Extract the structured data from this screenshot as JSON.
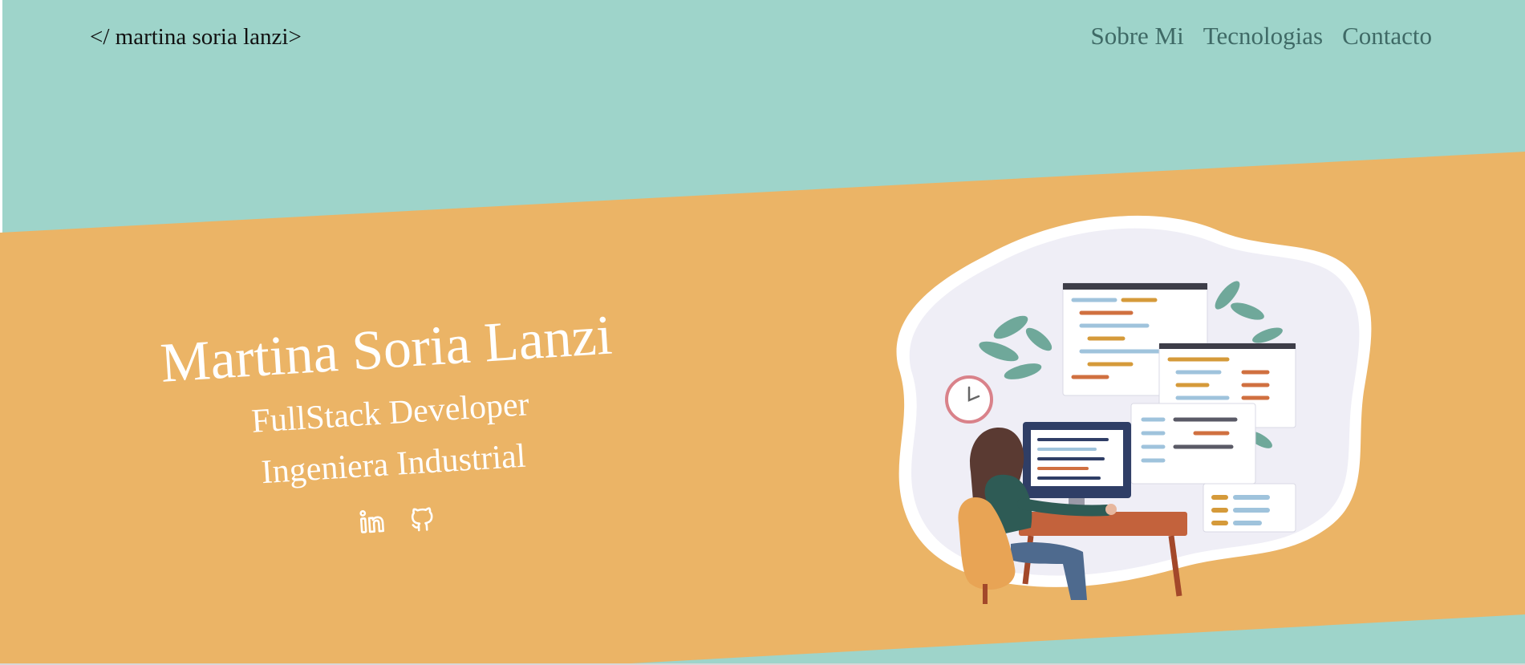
{
  "header": {
    "logo": "</ martina soria lanzi>",
    "nav": [
      {
        "label": "Sobre Mi"
      },
      {
        "label": "Tecnologias"
      },
      {
        "label": "Contacto"
      }
    ]
  },
  "hero": {
    "name": "Martina Soria Lanzi",
    "role1": "FullStack Developer",
    "role2": "Ingeniera Industrial",
    "social": [
      {
        "icon": "linkedin-icon"
      },
      {
        "icon": "github-icon"
      }
    ]
  },
  "colors": {
    "teal": "#9ed4ca",
    "orange": "#ebb466",
    "nav_text": "#3f6a66",
    "white": "#ffffff"
  }
}
